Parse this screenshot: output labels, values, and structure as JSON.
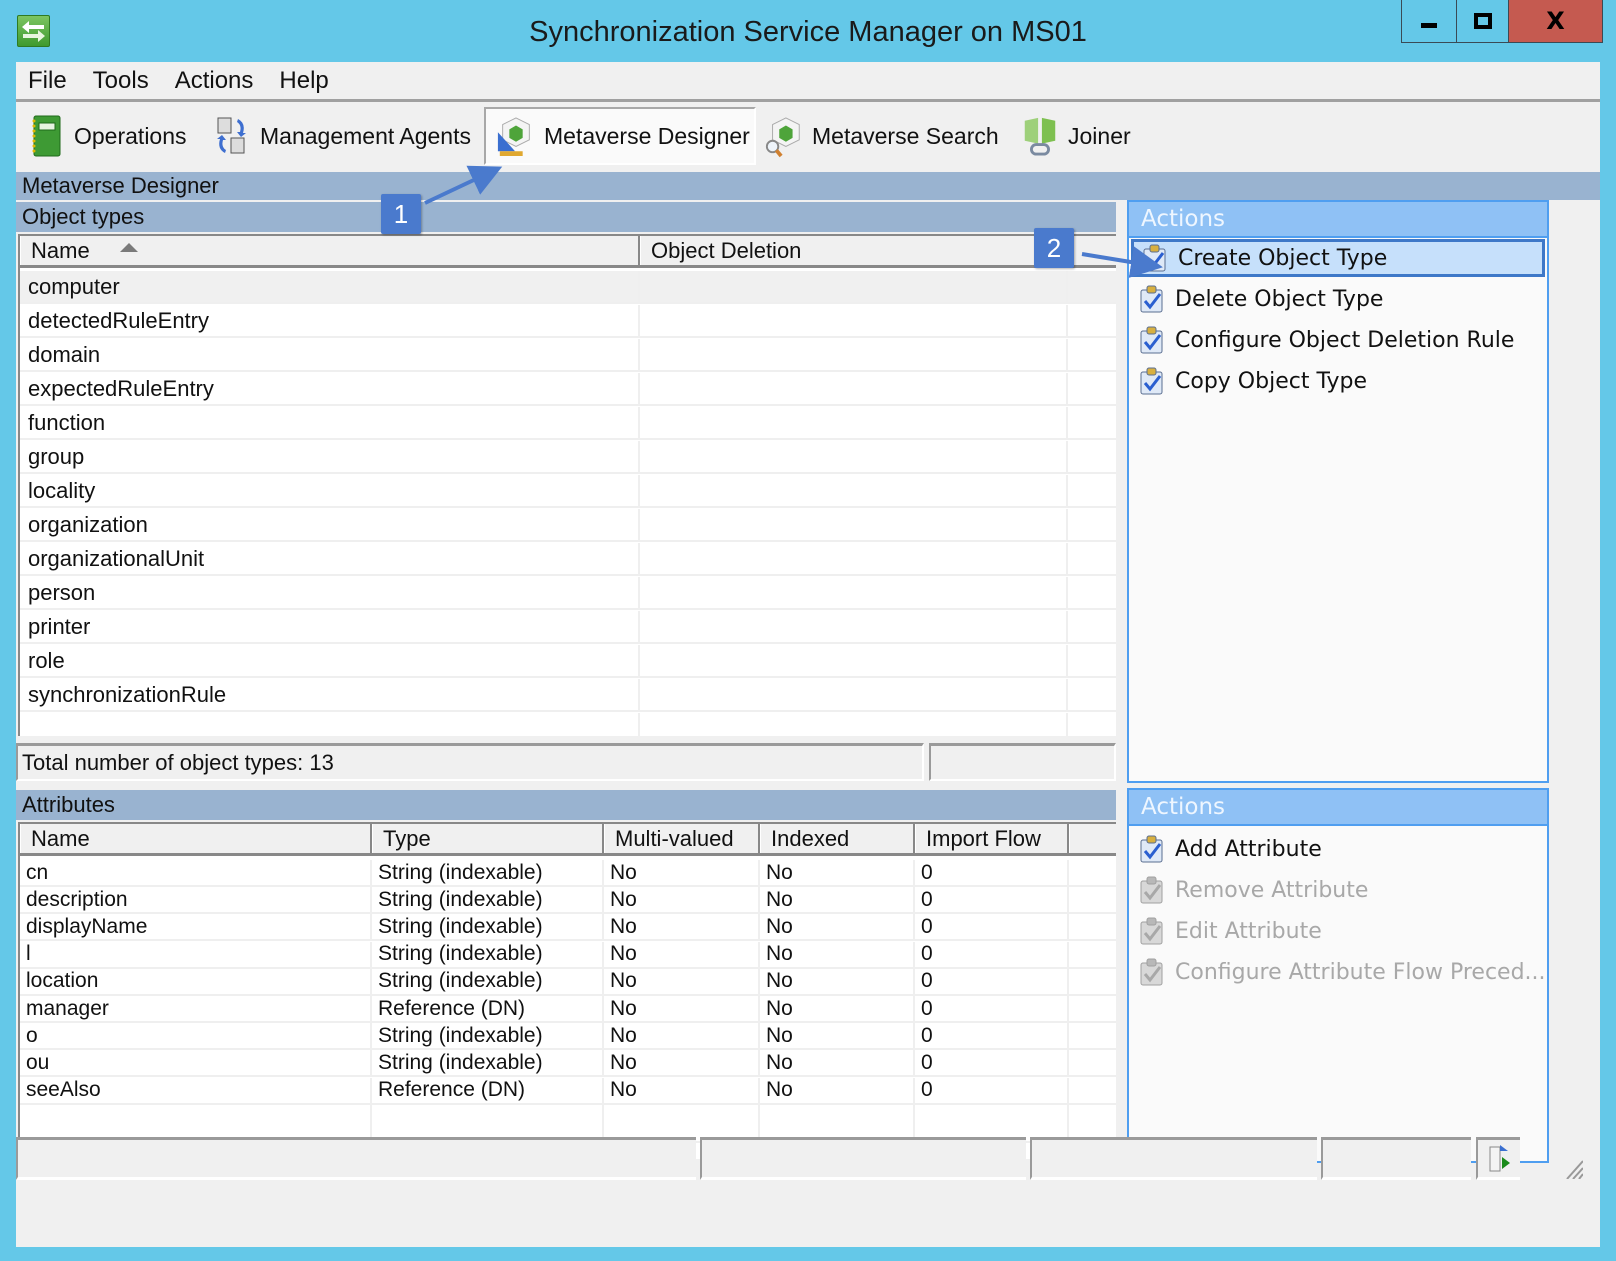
{
  "window": {
    "title": "Synchronization Service Manager on MS01",
    "app_icon": "sync-arrows-icon",
    "controls": {
      "minimize": "minimize-icon",
      "maximize": "maximize-icon",
      "close": "close-icon",
      "close_glyph": "X"
    }
  },
  "menu": {
    "items": [
      "File",
      "Tools",
      "Actions",
      "Help"
    ]
  },
  "toolbar": {
    "buttons": [
      {
        "label": "Operations",
        "icon": "operations-book-icon",
        "active": false
      },
      {
        "label": "Management Agents",
        "icon": "management-agents-icon",
        "active": false
      },
      {
        "label": "Metaverse Designer",
        "icon": "metaverse-designer-icon",
        "active": true
      },
      {
        "label": "Metaverse Search",
        "icon": "metaverse-search-icon",
        "active": false
      },
      {
        "label": "Joiner",
        "icon": "joiner-icon",
        "active": false
      }
    ]
  },
  "section_title": "Metaverse Designer",
  "object_types": {
    "title": "Object types",
    "columns": [
      "Name",
      "Object Deletion"
    ],
    "sort_column": "Name",
    "sort_direction": "ascending",
    "rows": [
      "computer",
      "detectedRuleEntry",
      "domain",
      "expectedRuleEntry",
      "function",
      "group",
      "locality",
      "organization",
      "organizationalUnit",
      "person",
      "printer",
      "role",
      "synchronizationRule"
    ],
    "selected": "computer",
    "total_label": "Total number of object types: 13"
  },
  "object_actions": {
    "title": "Actions",
    "items": [
      {
        "label": "Create Object Type",
        "enabled": true,
        "highlighted": true
      },
      {
        "label": "Delete Object Type",
        "enabled": true,
        "highlighted": false
      },
      {
        "label": "Configure Object Deletion Rule",
        "enabled": true,
        "highlighted": false
      },
      {
        "label": "Copy Object Type",
        "enabled": true,
        "highlighted": false
      }
    ]
  },
  "attributes": {
    "title": "Attributes",
    "columns": [
      "Name",
      "Type",
      "Multi-valued",
      "Indexed",
      "Import Flow"
    ],
    "rows": [
      [
        "cn",
        "String (indexable)",
        "No",
        "No",
        "0"
      ],
      [
        "description",
        "String (indexable)",
        "No",
        "No",
        "0"
      ],
      [
        "displayName",
        "String (indexable)",
        "No",
        "No",
        "0"
      ],
      [
        "l",
        "String (indexable)",
        "No",
        "No",
        "0"
      ],
      [
        "location",
        "String (indexable)",
        "No",
        "No",
        "0"
      ],
      [
        "manager",
        "Reference (DN)",
        "No",
        "No",
        "0"
      ],
      [
        "o",
        "String (indexable)",
        "No",
        "No",
        "0"
      ],
      [
        "ou",
        "String (indexable)",
        "No",
        "No",
        "0"
      ],
      [
        "seeAlso",
        "Reference (DN)",
        "No",
        "No",
        "0"
      ]
    ]
  },
  "attribute_actions": {
    "title": "Actions",
    "items": [
      {
        "label": "Add Attribute",
        "enabled": true
      },
      {
        "label": "Remove Attribute",
        "enabled": false
      },
      {
        "label": "Edit Attribute",
        "enabled": false
      },
      {
        "label": "Configure Attribute Flow Preced...",
        "enabled": false
      }
    ]
  },
  "callouts": [
    {
      "number": "1",
      "target": "Metaverse Designer toolbar button"
    },
    {
      "number": "2",
      "target": "Create Object Type action"
    }
  ],
  "colors": {
    "titlebar": "#64c8e8",
    "band": "#99b3d0",
    "actions_header": "#8fc1f5",
    "actions_border": "#4f9ef0",
    "highlight": "#c6e0fb",
    "callout": "#4a7acd",
    "close_button": "#c55a50"
  }
}
